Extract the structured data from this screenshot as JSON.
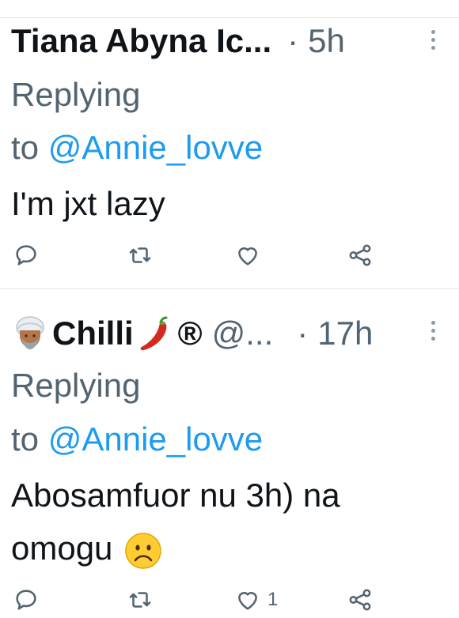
{
  "tweets": [
    {
      "name": "Tiana Abyna Ic...",
      "handle": "",
      "separator": "·",
      "time": "5h",
      "replying_prefix": "Replying",
      "replying_to_word": "to",
      "replying_to": "@Annie_lovve",
      "text_lines": [
        "I'm jxt lazy"
      ],
      "actions": {
        "reply_count": "",
        "retweet_count": "",
        "like_count": ""
      }
    },
    {
      "name": "Chilli",
      "name_suffix": "®",
      "handle": "@...",
      "separator": "·",
      "time": "17h",
      "replying_prefix": "Replying",
      "replying_to_word": "to",
      "replying_to": "@Annie_lovve",
      "text_lines": [
        "Abosamfuor nu 3h) na",
        "omogu"
      ],
      "actions": {
        "reply_count": "",
        "retweet_count": "",
        "like_count": "1"
      }
    }
  ],
  "icons": {
    "reply": "reply-icon",
    "retweet": "retweet-icon",
    "like": "heart-icon",
    "share": "share-icon",
    "more": "more-vertical-icon",
    "avatar": "turban-avatar-icon",
    "chili": "chili-pepper-emoji",
    "frown": "frowning-face-emoji"
  },
  "colors": {
    "text": "#0f1419",
    "muted": "#536471",
    "link": "#1d9bf0",
    "divider": "#e1e6ea"
  }
}
